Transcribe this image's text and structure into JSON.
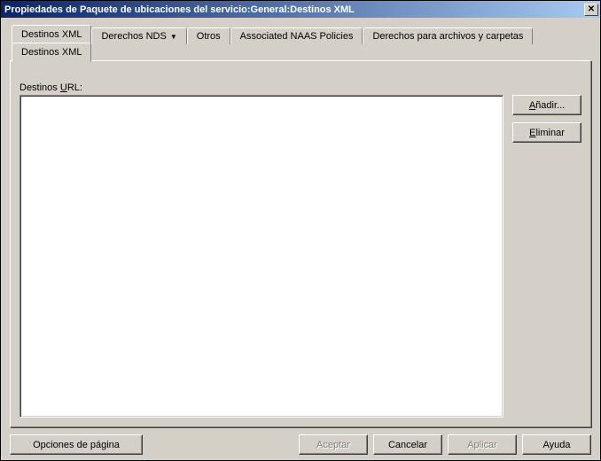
{
  "window": {
    "title": "Propiedades de Paquete de ubicaciones del servicio:General:Destinos XML",
    "close_glyph": "✕"
  },
  "tabs": {
    "main": [
      {
        "label": "Destinos XML",
        "active": true,
        "has_dropdown": false
      },
      {
        "label": "Derechos NDS",
        "active": false,
        "has_dropdown": true
      },
      {
        "label": "Otros",
        "active": false,
        "has_dropdown": false
      },
      {
        "label": "Associated NAAS Policies",
        "active": false,
        "has_dropdown": false
      },
      {
        "label": "Derechos para archivos y carpetas",
        "active": false,
        "has_dropdown": false
      }
    ],
    "sub": [
      {
        "label": "Destinos XML",
        "active": true
      }
    ]
  },
  "panel": {
    "field_label_pre": "Destinos ",
    "field_label_accel": "U",
    "field_label_post": "RL:",
    "list_items": []
  },
  "side_buttons": {
    "add_pre": "",
    "add_accel": "A",
    "add_post": "ñadir...",
    "remove_pre": "",
    "remove_accel": "E",
    "remove_post": "liminar"
  },
  "buttons": {
    "page_options": "Opciones de página",
    "ok": "Aceptar",
    "cancel": "Cancelar",
    "apply": "Aplicar",
    "help": "Ayuda"
  }
}
